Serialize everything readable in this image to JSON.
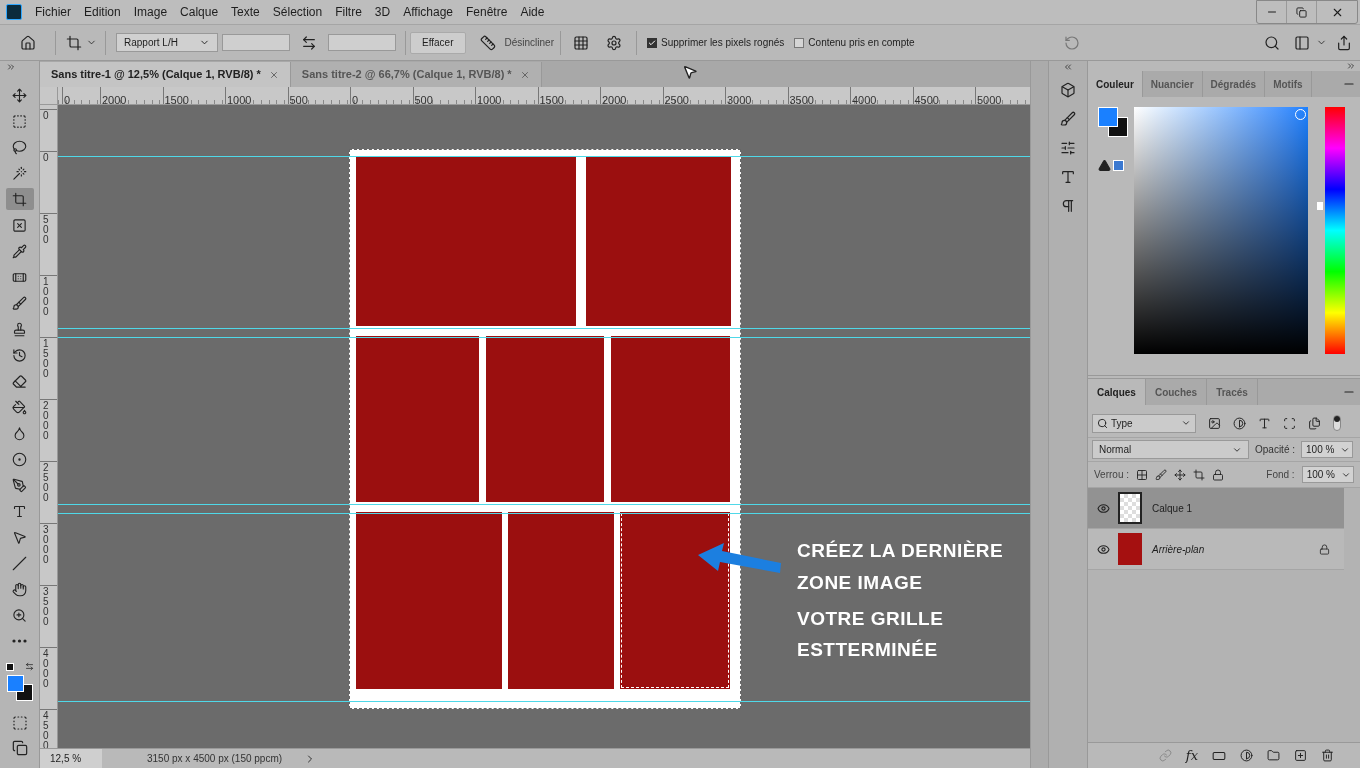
{
  "menu_bar": {
    "items": [
      "Fichier",
      "Edition",
      "Image",
      "Calque",
      "Texte",
      "Sélection",
      "Filtre",
      "3D",
      "Affichage",
      "Fenêtre",
      "Aide"
    ]
  },
  "options_bar": {
    "ratio_select": "Rapport L/H",
    "clear_button": "Effacer",
    "straighten_label": "Désincliner",
    "checkboxes": [
      {
        "label": "Supprimer les pixels rognés",
        "checked": true
      },
      {
        "label": "Contenu pris en compte",
        "checked": false
      }
    ]
  },
  "document_tabs": [
    {
      "title": "Sans titre-1 @ 12,5% (Calque 1, RVB/8) *",
      "selected": true
    },
    {
      "title": "Sans titre-2 @ 66,7% (Calque 1, RVB/8) *",
      "selected": false
    }
  ],
  "rulers": {
    "horizontal": [
      "0",
      "2000",
      "1500",
      "1000",
      "500",
      "0",
      "500",
      "1000",
      "1500",
      "2000",
      "2500",
      "3000",
      "3500",
      "4000",
      "4500",
      "5000"
    ],
    "vertical": [
      "0",
      "0",
      "500",
      "1000",
      "1500",
      "2000",
      "2500",
      "3000",
      "3500",
      "4000",
      "4500"
    ]
  },
  "tools": [
    {
      "selected": false
    },
    {
      "selected": false
    },
    {
      "selected": false
    },
    {
      "selected": false
    },
    {
      "selected": true
    },
    {
      "selected": false
    },
    {
      "selected": false
    },
    {
      "selected": false
    },
    {
      "selected": false
    },
    {
      "selected": false
    },
    {
      "selected": false
    },
    {
      "selected": false
    },
    {
      "selected": false
    },
    {
      "selected": false
    },
    {
      "selected": false
    },
    {
      "selected": false
    },
    {
      "selected": false
    },
    {
      "selected": false
    },
    {
      "selected": false
    },
    {
      "selected": false
    },
    {
      "selected": false
    },
    {
      "selected": false
    }
  ],
  "canvas": {
    "panel_rows": [
      [
        {
          "selected": false
        },
        {
          "selected": false
        }
      ],
      [
        {
          "selected": false
        },
        {
          "selected": false
        },
        {
          "selected": false
        }
      ],
      [
        {
          "selected": false
        },
        {
          "selected": false
        },
        {
          "selected": true
        }
      ]
    ],
    "annotation": [
      "CRÉEZ LA DERNIÈRE",
      "ZONE IMAGE",
      "VOTRE GRILLE",
      "ESTTERMINÉE"
    ]
  },
  "status_bar": {
    "zoom": "12,5 %",
    "size": "3150 px x 4500 px (150 ppcm)"
  },
  "color_panel": {
    "tabs": [
      {
        "label": "Couleur",
        "selected": true
      },
      {
        "label": "Nuancier",
        "selected": false
      },
      {
        "label": "Dégradés",
        "selected": false
      },
      {
        "label": "Motifs",
        "selected": false
      }
    ],
    "hue_slider": {
      "level": 0.6
    }
  },
  "layers_panel": {
    "tabs": [
      {
        "label": "Calques",
        "selected": true
      },
      {
        "label": "Couches",
        "selected": false
      },
      {
        "label": "Tracés",
        "selected": false
      }
    ],
    "filter": "Type",
    "blend_mode": "Normal",
    "opacity_label": "Opacité :",
    "opacity": "100 %",
    "lock_label": "Verrou :",
    "fill_label": "Fond :",
    "fill": "100 %",
    "layers": [
      {
        "name": "Calque 1",
        "kind": "transparent",
        "selected": true,
        "visible": true,
        "locked": false
      },
      {
        "name": "Arrière-plan",
        "kind": "background",
        "selected": false,
        "visible": true,
        "locked": true
      }
    ],
    "footer_fx": "fx"
  }
}
